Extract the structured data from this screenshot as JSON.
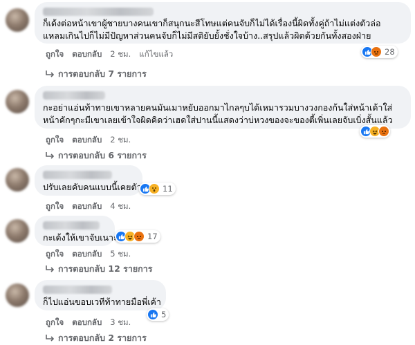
{
  "comments": [
    {
      "text_lines": [
        "ก็เด้งต่อหน้าเขาผู้ชายบางคนเขาก็สนุกนะสีโทษแต่คนจับก็ไม่ได้เรื่องนี้ผิดทั้งคู่ถ้าไม่แต่งตัวล่อ",
        "แหลมเกินไปก็ไม่มีปัญหาส่วนคนจับก็ไม่มีสติยับยั้งชั่งใจบ้าง..สรุปแล้วผิดด้วยกันทั้งสองฝ่าย"
      ],
      "reactions": {
        "icons": [
          "like-icon",
          "angry-icon"
        ],
        "count": "28"
      },
      "actions": {
        "like": "ถูกใจ",
        "reply": "ตอบกลับ",
        "time": "2 ชม.",
        "edited": "แก้ไขแล้ว"
      },
      "replies_label": "การตอบกลับ 7 รายการ"
    },
    {
      "text_lines": [
        "กะอย่าแอ่นท้าทายเขาหลายคนมันเมาหยับออกมาไกลๆบได้เหมารวมบางวงกองก้นใส่หน้าเด้าใส่",
        "หน้าคักๆกะมีเขาเลยเข้าใจผิดคิดว่าเฮดใส่ปานนี้แสดงว่าบ่หวงของจะของตี้เพิ่นเลยจับเบิ่งสั้นแล้ว"
      ],
      "reactions": {
        "icons": [
          "like-icon",
          "haha-icon",
          "angry-icon"
        ],
        "count": ""
      },
      "actions": {
        "like": "ถูกใจ",
        "reply": "ตอบกลับ",
        "time": "2 ชม."
      },
      "replies_label": "การตอบกลับ 6 รายการ"
    },
    {
      "text_lines": [
        "ปรับเลยคับคนแบบนี้เคยตัว"
      ],
      "reactions": {
        "icons": [
          "like-icon",
          "wow-icon"
        ],
        "count": "11"
      },
      "actions": {
        "like": "ถูกใจ",
        "reply": "ตอบกลับ",
        "time": "4 ชม."
      }
    },
    {
      "text_lines": [
        "กะเด้งให้เขาจับเนาะ"
      ],
      "reactions": {
        "icons": [
          "like-icon",
          "haha-icon",
          "angry-icon"
        ],
        "count": "17"
      },
      "actions": {
        "like": "ถูกใจ",
        "reply": "ตอบกลับ",
        "time": "5 ชม."
      },
      "replies_label": "การตอบกลับ 12 รายการ"
    },
    {
      "text_lines": [
        "ก็ไปแอ่นขอบเวทีท้าทายมือพี่เค้า"
      ],
      "reactions": {
        "icons": [
          "like-icon"
        ],
        "count": "5"
      },
      "actions": {
        "like": "ถูกใจ",
        "reply": "ตอบกลับ",
        "time": "3 ชม."
      },
      "replies_label": "การตอบกลับ 2 รายการ"
    }
  ],
  "colors": {
    "bubble": "#f0f2f5",
    "like": "#1877f2",
    "angry": "#e9710f",
    "haha": "#f7b125",
    "meta": "#65676b"
  }
}
